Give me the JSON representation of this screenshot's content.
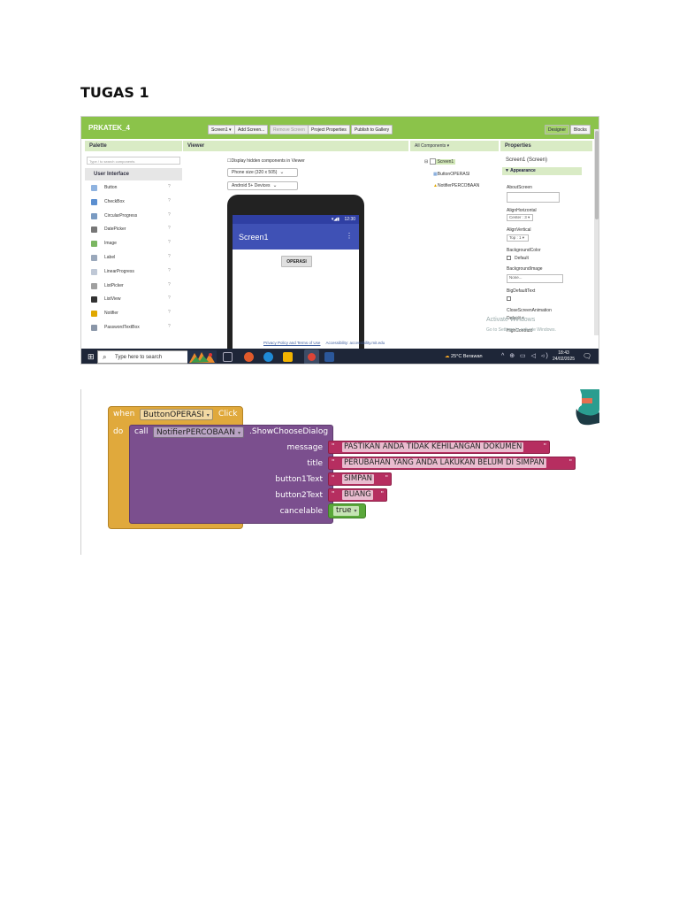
{
  "document": {
    "title": "TUGAS 1"
  },
  "appinventor": {
    "project_name": "PRKATEK_4",
    "toolbar": {
      "screen_select": "Screen1 ▾",
      "add_screen": "Add Screen...",
      "remove_screen": "Remove Screen",
      "project_properties": "Project Properties",
      "publish": "Publish to Gallery",
      "designer": "Designer",
      "blocks": "Blocks"
    },
    "palette": {
      "header": "Palette",
      "search_placeholder": "Type / to search components",
      "category": "User Interface",
      "help_glyph": "?",
      "items": [
        {
          "label": "Button",
          "icon": "button-icon",
          "color": "#8fb3e0"
        },
        {
          "label": "CheckBox",
          "icon": "checkbox-icon",
          "color": "#5b8fd0"
        },
        {
          "label": "CircularProgress",
          "icon": "circular-progress-icon",
          "color": "#7a9bc2"
        },
        {
          "label": "DatePicker",
          "icon": "datepicker-icon",
          "color": "#777777"
        },
        {
          "label": "Image",
          "icon": "image-icon",
          "color": "#7bb661"
        },
        {
          "label": "Label",
          "icon": "label-icon",
          "color": "#9aa8bb"
        },
        {
          "label": "LinearProgress",
          "icon": "linear-progress-icon",
          "color": "#bfc8d6"
        },
        {
          "label": "ListPicker",
          "icon": "listpicker-icon",
          "color": "#a0a0a0"
        },
        {
          "label": "ListView",
          "icon": "listview-icon",
          "color": "#333333"
        },
        {
          "label": "Notifier",
          "icon": "notifier-icon",
          "color": "#e0a800"
        },
        {
          "label": "PasswordTextBox",
          "icon": "password-icon",
          "color": "#8a96a8"
        }
      ]
    },
    "viewer": {
      "header": "Viewer",
      "hidden_checkbox": "Display hidden components in Viewer",
      "phone_size": "Phone size (320 x 505)",
      "device": "Android 5+ Devices",
      "status_time": "12:30",
      "screen_title": "Screen1",
      "button_text": "OPERASI"
    },
    "components": {
      "header": "All Components ▾",
      "root": "Screen1",
      "children": [
        "ButtonOPERASI",
        "NotifierPERCOBAAN"
      ]
    },
    "properties": {
      "header": "Properties",
      "component": "Screen1 (Screen)",
      "group": "▼ Appearance",
      "labels": {
        "about": "AboutScreen",
        "align_h": "AlignHorizontal",
        "align_v": "AlignVertical",
        "bg_color": "BackgroundColor",
        "bg_image": "BackgroundImage",
        "big_text": "BigDefaultText",
        "close_anim": "CloseScreenAnimation",
        "high_contrast": "HighContrast"
      },
      "values": {
        "align_h": "Center : 3 ▾",
        "align_v": "Top : 1 ▾",
        "bg_color": "Default",
        "bg_image": "None...",
        "close_anim": "Default ▾"
      }
    },
    "watermark": {
      "line1": "Activate Windows",
      "line2": "Go to Settings to activate Windows."
    },
    "footer": {
      "privacy": "Privacy Policy and Terms of Use",
      "accessibility": "Accessibility: accessibility.mit.edu"
    }
  },
  "taskbar": {
    "search_placeholder": "Type here to search",
    "weather": "25°C Berawan",
    "tray": "^ ⊕ ▭ ◁ ◃)",
    "time": "18:43",
    "date": "24/02/2025"
  },
  "blocks": {
    "event": {
      "when": "when",
      "component": "ButtonOPERASI",
      "event": "Click",
      "do": "do"
    },
    "call": {
      "keyword": "call",
      "component": "NotifierPERCOBAAN",
      "method": ".ShowChooseDialog"
    },
    "args": [
      {
        "name": "message",
        "value": "PASTIKAN ANDA TIDAK KEHILANGAN DOKUMEN"
      },
      {
        "name": "title",
        "value": "PERUBAHAN YANG ANDA LAKUKAN BELUM DI SIMPAN"
      },
      {
        "name": "button1Text",
        "value": "SIMPAN"
      },
      {
        "name": "button2Text",
        "value": "BUANG"
      },
      {
        "name": "cancelable",
        "value": "true"
      }
    ],
    "quote_glyph": "\"",
    "colors": {
      "event": "#e0a93c",
      "procedure": "#7b4f8e",
      "text": "#b62e60",
      "logic": "#5aa83b"
    }
  }
}
